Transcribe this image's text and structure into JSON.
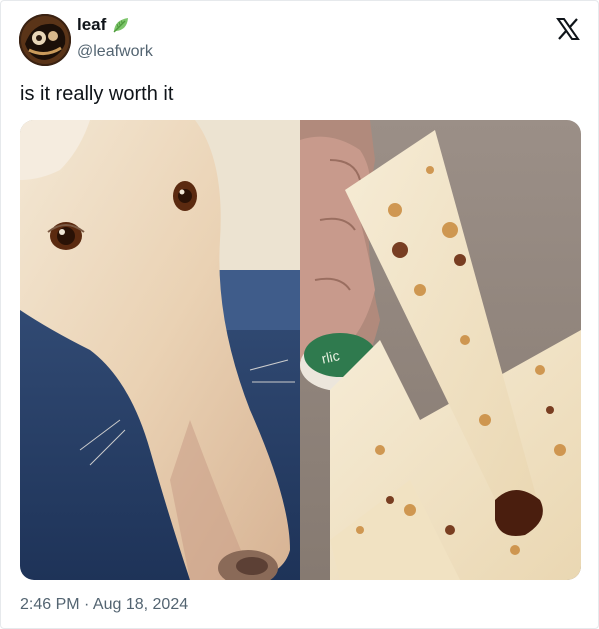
{
  "author": {
    "display_name": "leaf",
    "handle": "@leafwork",
    "badge_icon": "leaf-icon",
    "avatar_icon": "avatar"
  },
  "platform_icon": "x-logo-icon",
  "tweet": {
    "text": "is it really worth it",
    "timestamp": "2:46 PM · Aug 18, 2024"
  },
  "media": {
    "left_image": "borzoi-dog-photo",
    "right_image": "cheese-breadstick-photo",
    "cup_label": "rlic"
  },
  "colors": {
    "text_primary": "#0f1419",
    "text_secondary": "#536471",
    "border": "#e6e9ec",
    "leaf_green": "#7cc56a"
  }
}
